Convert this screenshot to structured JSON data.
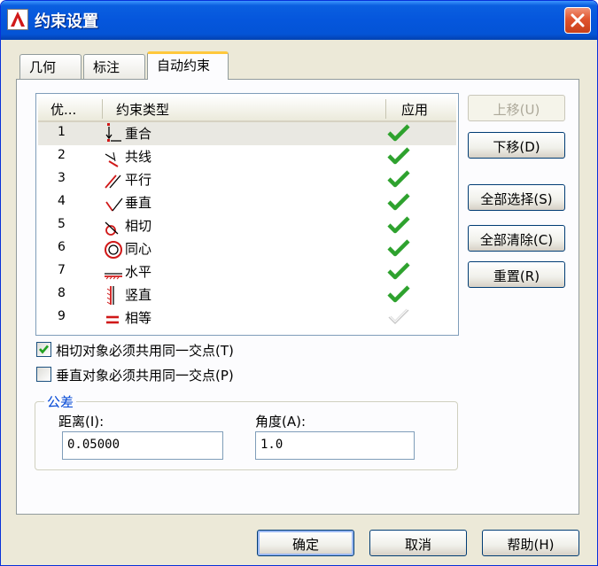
{
  "window": {
    "title": "约束设置"
  },
  "tabs": [
    {
      "label": "几何",
      "active": false
    },
    {
      "label": "标注",
      "active": false
    },
    {
      "label": "自动约束",
      "active": true
    }
  ],
  "list": {
    "headers": {
      "priority": "优...",
      "type": "约束类型",
      "apply": "应用"
    },
    "rows": [
      {
        "priority": "1",
        "type": "重合",
        "icon": "coincident-icon",
        "applied": true
      },
      {
        "priority": "2",
        "type": "共线",
        "icon": "collinear-icon",
        "applied": true
      },
      {
        "priority": "3",
        "type": "平行",
        "icon": "parallel-icon",
        "applied": true
      },
      {
        "priority": "4",
        "type": "垂直",
        "icon": "perpendicular-icon",
        "applied": true
      },
      {
        "priority": "5",
        "type": "相切",
        "icon": "tangent-icon",
        "applied": true
      },
      {
        "priority": "6",
        "type": "同心",
        "icon": "concentric-icon",
        "applied": true
      },
      {
        "priority": "7",
        "type": "水平",
        "icon": "horizontal-icon",
        "applied": true
      },
      {
        "priority": "8",
        "type": "竖直",
        "icon": "vertical-icon",
        "applied": true
      },
      {
        "priority": "9",
        "type": "相等",
        "icon": "equal-icon",
        "applied": false
      }
    ]
  },
  "side_buttons": {
    "move_up": "上移(U)",
    "move_down": "下移(D)",
    "select_all": "全部选择(S)",
    "clear_all": "全部清除(C)",
    "reset": "重置(R)"
  },
  "checkboxes": {
    "tangent": {
      "label": "相切对象必须共用同一交点(T)",
      "checked": true
    },
    "perpendicular": {
      "label": "垂直对象必须共用同一交点(P)",
      "checked": false
    }
  },
  "tolerance": {
    "title": "公差",
    "distance_label": "距离(I):",
    "distance_value": "0.05000",
    "angle_label": "角度(A):",
    "angle_value": "1.0"
  },
  "footer": {
    "ok": "确定",
    "cancel": "取消",
    "help": "帮助(H)"
  },
  "colors": {
    "accent": "#0054e3",
    "check": "#2ea22e",
    "icon_red": "#d01818",
    "close": "#e0542e"
  }
}
